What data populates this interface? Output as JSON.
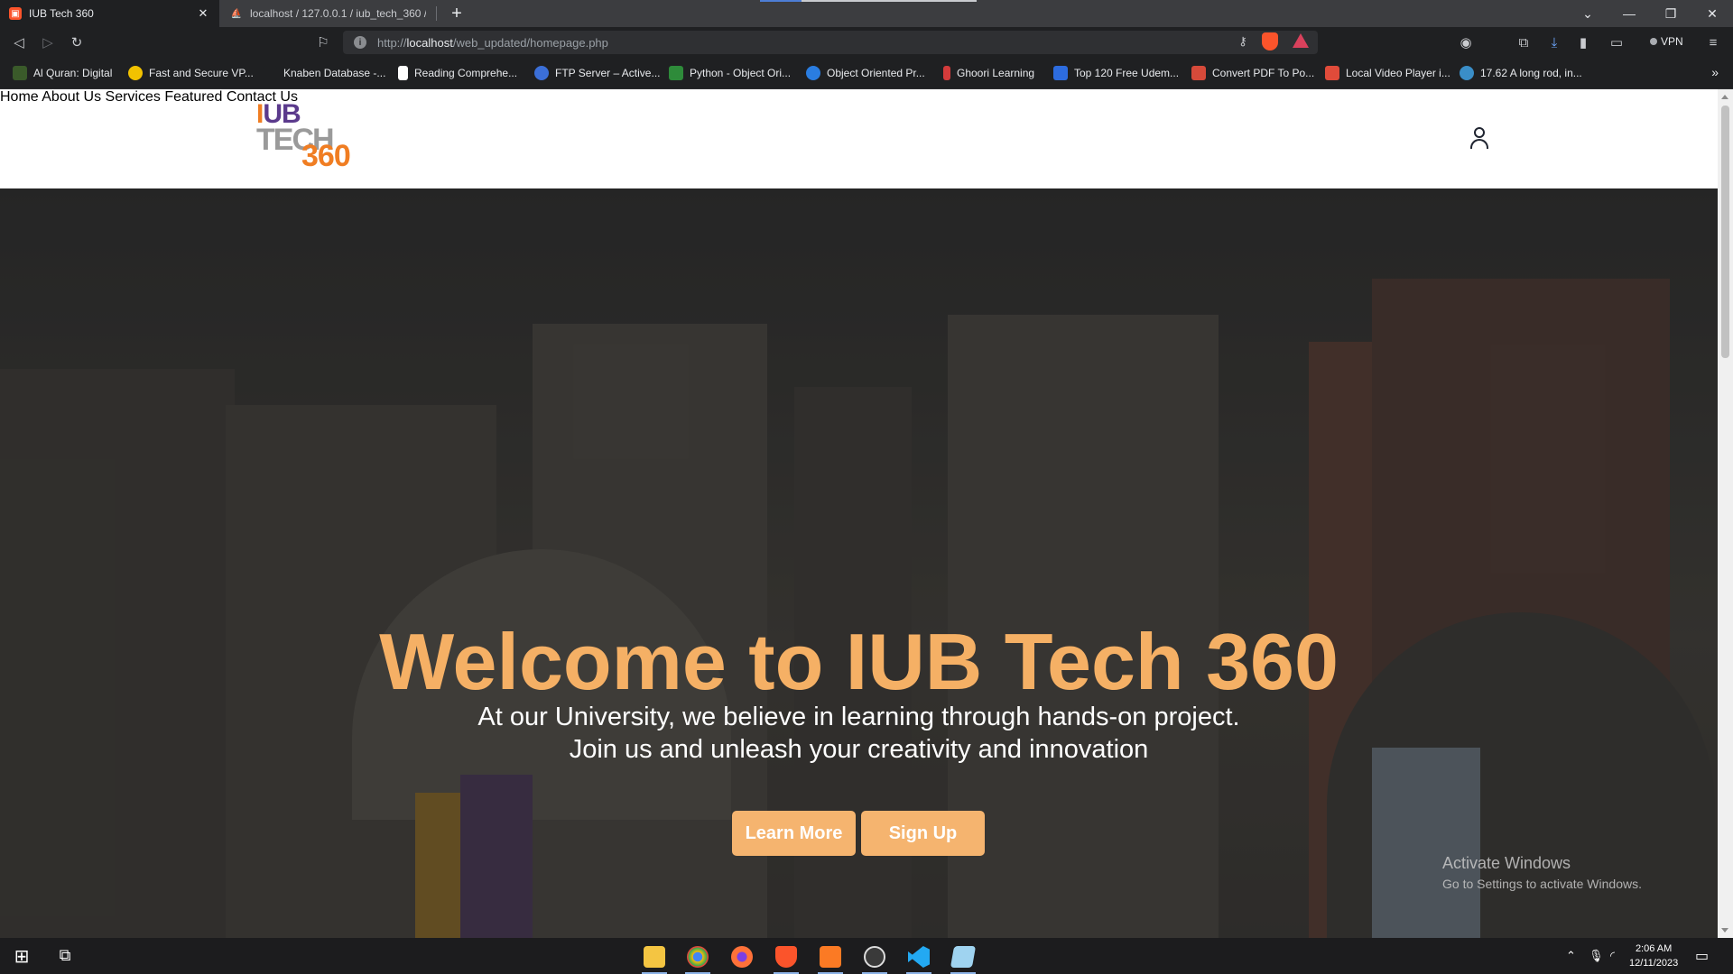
{
  "browser": {
    "tabs": [
      {
        "title": "IUB Tech 360",
        "active": true
      },
      {
        "title": "localhost / 127.0.0.1 / iub_tech_360 / u",
        "active": false
      }
    ],
    "new_tab": "+",
    "url_prefix": "http://",
    "url_host": "localhost",
    "url_path": "/web_updated/homepage.php",
    "vpn_label": "VPN",
    "bookmarks": [
      {
        "label": "Al Quran: Digital",
        "color": "#3a5a2a"
      },
      {
        "label": "Fast and Secure VP...",
        "color": "#f2c200"
      },
      {
        "label": "Knaben Database -...",
        "color": "#1f2022"
      },
      {
        "label": "Reading Comprehe...",
        "color": "#ffffff"
      },
      {
        "label": "FTP Server – Active...",
        "color": "#3b6fd8"
      },
      {
        "label": "Python - Object Ori...",
        "color": "#2e8b3a"
      },
      {
        "label": "Object Oriented Pr...",
        "color": "#2a7de1"
      },
      {
        "label": "Ghoori Learning",
        "color": "#d33b3b"
      },
      {
        "label": "Top 120 Free Udem...",
        "color": "#2d6cdf"
      },
      {
        "label": "Convert PDF To Po...",
        "color": "#d64a3a"
      },
      {
        "label": "Local Video Player i...",
        "color": "#e04b3a"
      },
      {
        "label": "17.62 A long rod, in...",
        "color": "#3a8ec8"
      }
    ],
    "bookmarks_more": "»"
  },
  "site": {
    "logo": {
      "line1_i": "I",
      "line1_ub": "UB",
      "line2": "TECH",
      "line3": "360"
    },
    "nav": [
      "Home",
      "About Us",
      "Services",
      "Featured",
      "Contact Us"
    ],
    "hero": {
      "title": "Welcome to IUB Tech 360",
      "subtitle_line1": "At our University, we believe in learning through hands-on project.",
      "subtitle_line2": "Join us and unleash your creativity and innovation",
      "primary_button": "Learn More",
      "secondary_button": "Sign Up"
    },
    "watermark": {
      "line1": "Activate Windows",
      "line2": "Go to Settings to activate Windows."
    }
  },
  "taskbar": {
    "time": "2:06 AM",
    "date": "12/11/2023",
    "apps": [
      {
        "name": "file-explorer",
        "color": "#f4c542"
      },
      {
        "name": "chrome",
        "color": "#dd4b39"
      },
      {
        "name": "firefox",
        "color": "#ff7139"
      },
      {
        "name": "brave",
        "color": "#fb542b"
      },
      {
        "name": "xampp",
        "color": "#fb7a24"
      },
      {
        "name": "obs",
        "color": "#3a3a3a"
      },
      {
        "name": "vscode",
        "color": "#23a9f2"
      },
      {
        "name": "notepad",
        "color": "#9fd3f0"
      }
    ]
  }
}
